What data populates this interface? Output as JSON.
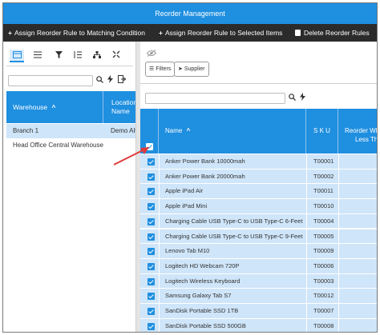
{
  "window": {
    "title": "Reorder Management"
  },
  "toolbar": {
    "assign_matching": "Assign Reorder Rule to Matching Condition",
    "assign_selected": "Assign Reorder Rule to Selected Items",
    "delete_rules": "Delete Reorder Rules",
    "plus_glyph": "+"
  },
  "left_panel": {
    "icons": [
      "table-view-icon",
      "list-icon",
      "filter-icon",
      "sort-list-icon",
      "hierarchy-icon",
      "collapse-icon"
    ],
    "columns": {
      "warehouse": "Warehouse",
      "location_line1": "Location",
      "location_line2": "Name"
    },
    "sort_glyph": "^",
    "rows": [
      {
        "warehouse": "Branch 1",
        "location": "Demo Alt"
      },
      {
        "warehouse": "Head Office Central Warehouse",
        "location": ""
      }
    ]
  },
  "right_panel": {
    "chips": {
      "filters": "Filters",
      "supplier": "Supplier"
    },
    "columns": {
      "name": "Name",
      "sku": "S K U",
      "reorder_line1": "Reorder Whe",
      "reorder_line2": "Less Tha"
    },
    "sort_glyph": "^",
    "rows": [
      {
        "name": "Anker Power Bank 10000mah",
        "sku": "T00001"
      },
      {
        "name": "Anker Power Bank 20000mah",
        "sku": "T00002"
      },
      {
        "name": "Apple iPad Air",
        "sku": "T00011"
      },
      {
        "name": "Apple iPad Mini",
        "sku": "T00010"
      },
      {
        "name": "Charging Cable USB Type-C to USB Type-C 6-Feet",
        "sku": "T00004"
      },
      {
        "name": "Charging Cable USB Type-C to USB Type-C 9-Feet",
        "sku": "T00005"
      },
      {
        "name": "Lenovo Tab M10",
        "sku": "T00009"
      },
      {
        "name": "Logitech HD Webcam 720P",
        "sku": "T00006"
      },
      {
        "name": "Logitech Wireless Keyboard",
        "sku": "T00003"
      },
      {
        "name": "Samsung Galaxy Tab S7",
        "sku": "T00012"
      },
      {
        "name": "SanDisk Portable SSD 1TB",
        "sku": "T00007"
      },
      {
        "name": "SanDisk Portable SSD 500GB",
        "sku": "T00008"
      }
    ]
  },
  "colors": {
    "accent": "#1f8fe0",
    "toolbar": "#2b2b2b",
    "row_selected": "#cfe5f9",
    "arrow": "#e03a3a"
  }
}
